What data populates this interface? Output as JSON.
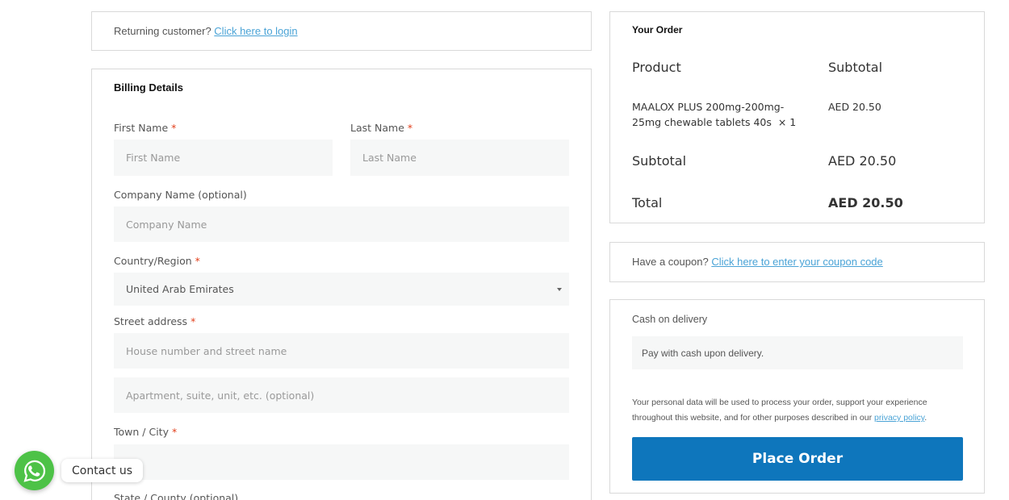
{
  "login_notice": {
    "text": "Returning customer?",
    "link": "Click here to login"
  },
  "billing": {
    "title": "Billing Details",
    "required_mark": "*",
    "first_name": {
      "label": "First Name",
      "placeholder": "First Name"
    },
    "last_name": {
      "label": "Last Name",
      "placeholder": "Last Name"
    },
    "company": {
      "label": "Company Name (optional)",
      "placeholder": "Company Name"
    },
    "country": {
      "label": "Country/Region",
      "value": "United Arab Emirates"
    },
    "street": {
      "label": "Street address",
      "placeholder": "House number and street name",
      "placeholder2": "Apartment, suite, unit, etc. (optional)"
    },
    "city": {
      "label": "Town / City"
    },
    "state": {
      "label": "State / County (optional)"
    }
  },
  "order": {
    "title": "Your Order",
    "col_product": "Product",
    "col_subtotal": "Subtotal",
    "item_name": "MAALOX PLUS 200mg-200mg-",
    "item_name_2": "25mg chewable tablets 40s",
    "item_qty": "× 1",
    "item_price": "AED 20.50",
    "subtotal_label": "Subtotal",
    "subtotal_value": "AED 20.50",
    "total_label": "Total",
    "total_value": "AED 20.50"
  },
  "coupon": {
    "text": "Have a coupon?",
    "link": "Click here to enter your coupon code"
  },
  "payment": {
    "method": "Cash on delivery",
    "description": "Pay with cash upon delivery.",
    "privacy_text": "Your personal data will be used to process your order, support your experience throughout this website, and for other purposes described in our",
    "privacy_link": "privacy policy",
    "privacy_end": ".",
    "button": "Place Order"
  },
  "whatsapp": {
    "label": "Contact us",
    "icon": "whatsapp-icon",
    "color": "#4dc247"
  },
  "colors": {
    "accent": "#0e76bc",
    "link": "#4aa3d6",
    "required": "#e2401c"
  }
}
